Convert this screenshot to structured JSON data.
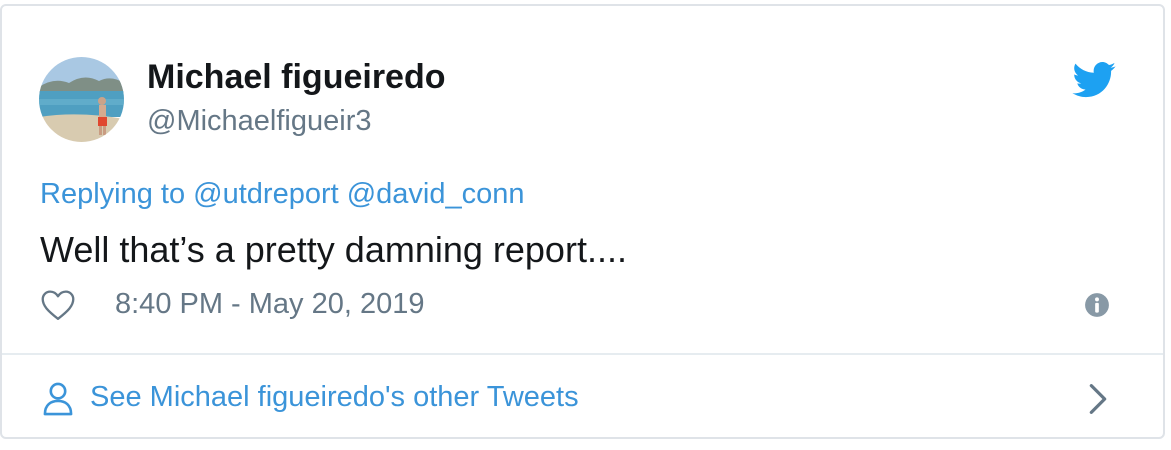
{
  "tweet": {
    "author": {
      "display_name": "Michael figueiredo",
      "handle": "@Michaelfigueir3",
      "avatar_icon": "beach-photo-avatar"
    },
    "brand_icon": "twitter-bird-icon",
    "reply": {
      "prefix": "Replying to",
      "mentions": [
        "@utdreport",
        "@david_conn"
      ]
    },
    "text": "Well that’s a pretty damning report....",
    "like_icon": "heart-outline-icon",
    "timestamp": "8:40 PM - May 20, 2019",
    "info_icon": "info-icon"
  },
  "footer": {
    "label": "See Michael figueiredo's other Tweets",
    "icon": "person-icon",
    "chevron_icon": "chevron-right-icon"
  },
  "colors": {
    "link": "#3b94d9",
    "text": "#14171a",
    "muted": "#657786",
    "twitter_blue": "#1da1f2",
    "border": "#dfe3e8"
  }
}
